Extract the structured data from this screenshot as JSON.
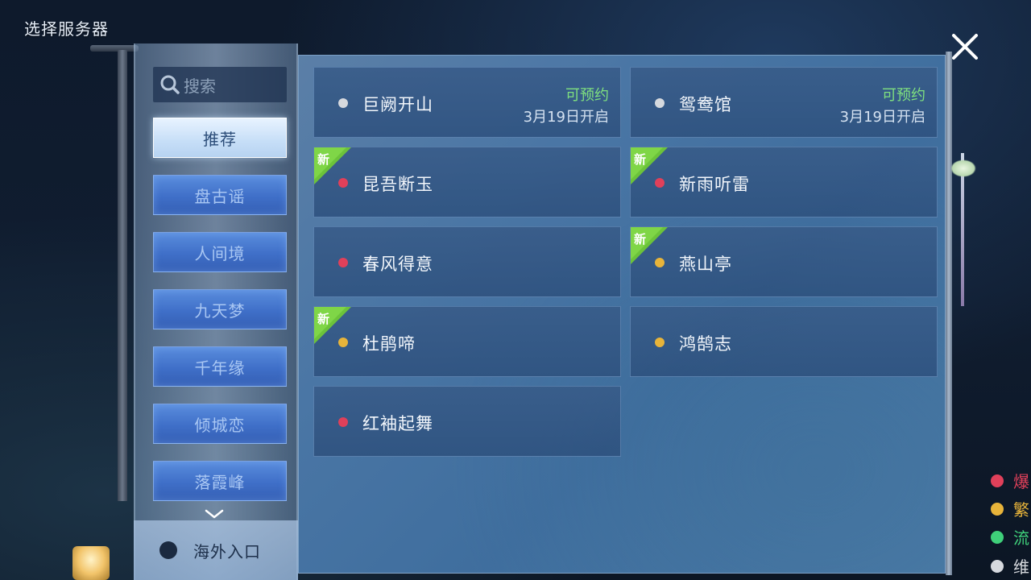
{
  "header": {
    "title": "选择服务器"
  },
  "search": {
    "placeholder": "搜索"
  },
  "categories": [
    {
      "label": "推荐",
      "active": true
    },
    {
      "label": "盘古谣",
      "active": false
    },
    {
      "label": "人间境",
      "active": false
    },
    {
      "label": "九天梦",
      "active": false
    },
    {
      "label": "千年缘",
      "active": false
    },
    {
      "label": "倾城恋",
      "active": false
    },
    {
      "label": "落霞峰",
      "active": false
    }
  ],
  "overseas": {
    "label": "海外入口"
  },
  "new_badge_text": "新",
  "status_colors": {
    "red": "#e0405a",
    "orange": "#e8b43a",
    "green": "#3fd07a",
    "grey": "#d6d9de"
  },
  "servers": [
    {
      "name": "巨阙开山",
      "status": "grey",
      "is_new": false,
      "tag": "可预约",
      "open_date": "3月19日开启"
    },
    {
      "name": "鸳鸯馆",
      "status": "grey",
      "is_new": false,
      "tag": "可预约",
      "open_date": "3月19日开启"
    },
    {
      "name": "昆吾断玉",
      "status": "red",
      "is_new": true,
      "tag": "",
      "open_date": ""
    },
    {
      "name": "新雨听雷",
      "status": "red",
      "is_new": true,
      "tag": "",
      "open_date": ""
    },
    {
      "name": "春风得意",
      "status": "red",
      "is_new": false,
      "tag": "",
      "open_date": ""
    },
    {
      "name": "燕山亭",
      "status": "orange",
      "is_new": true,
      "tag": "",
      "open_date": ""
    },
    {
      "name": "杜鹃啼",
      "status": "orange",
      "is_new": true,
      "tag": "",
      "open_date": ""
    },
    {
      "name": "鸿鹄志",
      "status": "orange",
      "is_new": false,
      "tag": "",
      "open_date": ""
    },
    {
      "name": "红袖起舞",
      "status": "red",
      "is_new": false,
      "tag": "",
      "open_date": ""
    }
  ],
  "legend": [
    {
      "label": "爆",
      "color": "red"
    },
    {
      "label": "繁",
      "color": "orange"
    },
    {
      "label": "流",
      "color": "green"
    },
    {
      "label": "维",
      "color": "grey"
    }
  ]
}
